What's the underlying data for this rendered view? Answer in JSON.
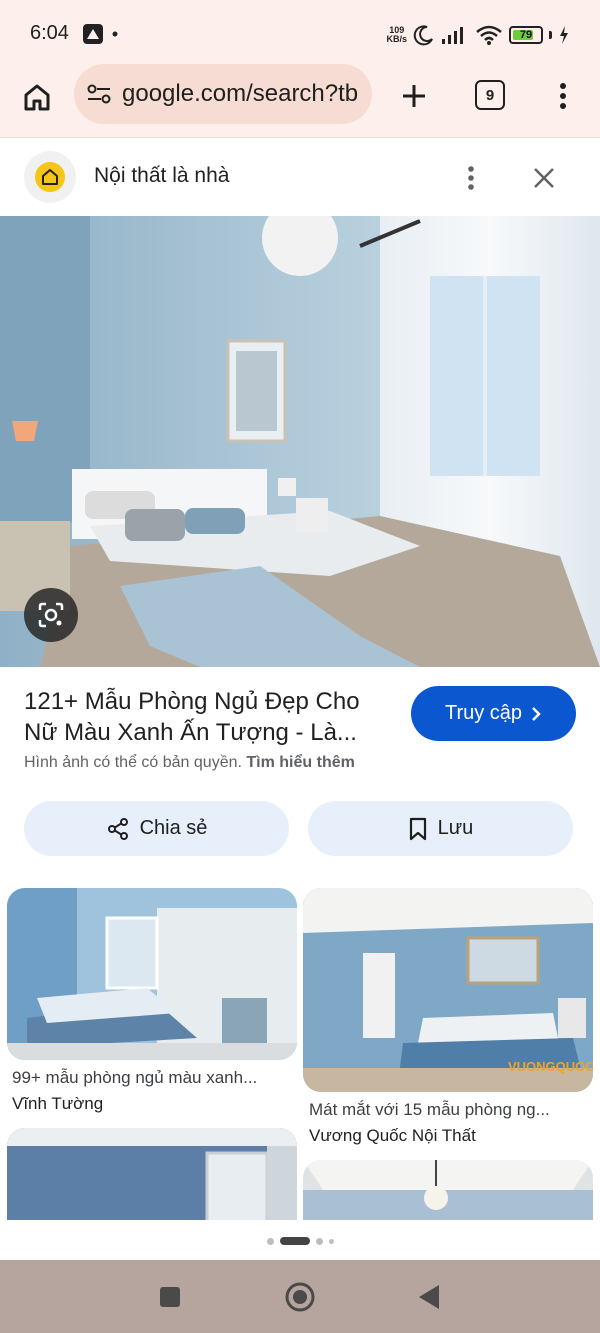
{
  "status_bar": {
    "time": "6:04",
    "net_speed_value": "109",
    "net_speed_unit": "KB/s",
    "battery": "79",
    "battery_level": 0.79,
    "icons": [
      "app-notification-icon",
      "dot-icon",
      "moon-icon",
      "signal-icon",
      "wifi-icon",
      "battery-icon",
      "charging-icon"
    ]
  },
  "browser": {
    "url": "google.com/search?tb",
    "tab_count": "9",
    "icons": [
      "home-icon",
      "site-settings-icon",
      "plus-icon",
      "tabs-icon",
      "more-vert-icon"
    ]
  },
  "source": {
    "name": "Nội thất là nhà",
    "icons": [
      "house-logo-icon",
      "more-vert-icon",
      "close-icon"
    ]
  },
  "result": {
    "title": "121+ Mẫu Phòng Ngủ Đẹp Cho Nữ Màu Xanh Ấn Tượng - Là...",
    "visit_label": "Truy cập",
    "copyright_text": "Hình ảnh có thể có bản quyền.",
    "learn_more": "Tìm hiểu thêm",
    "share_label": "Chia sẻ",
    "save_label": "Lưu"
  },
  "related": [
    {
      "caption": "99+ mẫu phòng ngủ màu xanh...",
      "source": "Vĩnh Tường"
    },
    {
      "caption": "Mát mắt với 15 mẫu phòng ng...",
      "source": "Vương Quốc Nội Thất",
      "watermark": "VUONGQUOC"
    }
  ],
  "pager": {
    "active_index": 1,
    "count": 4
  },
  "nav_bar": {
    "icons": [
      "recents-square-icon",
      "home-circle-icon",
      "back-triangle-icon"
    ]
  },
  "colors": {
    "chrome_bg": "#fdf0ec",
    "url_pill": "#f6dcd2",
    "primary_button": "#0b57d0",
    "secondary_button": "#e7effb",
    "nav_bar": "#b5a59e",
    "logo_yellow": "#f5c518"
  }
}
